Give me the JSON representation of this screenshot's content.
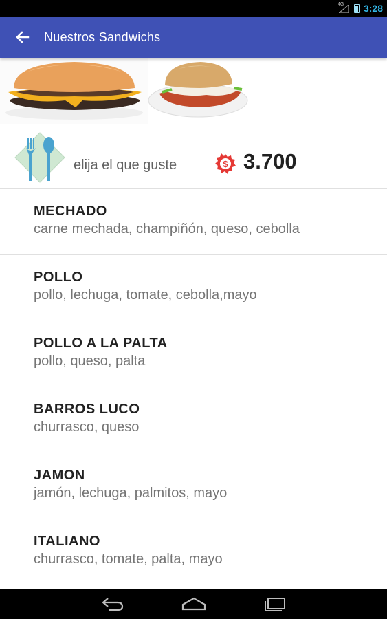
{
  "status_bar": {
    "network": "4G",
    "time": "3:28"
  },
  "app_bar": {
    "title": "Nuestros Sandwichs",
    "back_icon": "arrow-back-icon"
  },
  "banner": {
    "images": [
      "burger-image",
      "sandwich-plate-image"
    ]
  },
  "price_row": {
    "text": "elija el que guste",
    "price": "3.700",
    "price_icon": "dollar-seal-icon",
    "cutlery_icon": "fork-spoon-icon"
  },
  "menu": [
    {
      "name": "MECHADO",
      "desc": "carne mechada, champiñón, queso, cebolla"
    },
    {
      "name": "POLLO",
      "desc": "pollo, lechuga, tomate, cebolla,mayo"
    },
    {
      "name": "POLLO A LA PALTA",
      "desc": "pollo, queso, palta"
    },
    {
      "name": "BARROS LUCO",
      "desc": "churrasco, queso"
    },
    {
      "name": "JAMON",
      "desc": "jamón, lechuga, palmitos, mayo"
    },
    {
      "name": "ITALIANO",
      "desc": "churrasco, tomate, palta, mayo"
    }
  ],
  "colors": {
    "app_bar": "#3f51b5",
    "status_accent": "#33b5e5",
    "price_badge": "#e53935"
  },
  "nav_bar": {
    "icons": [
      "back-icon",
      "home-icon",
      "recents-icon"
    ]
  }
}
